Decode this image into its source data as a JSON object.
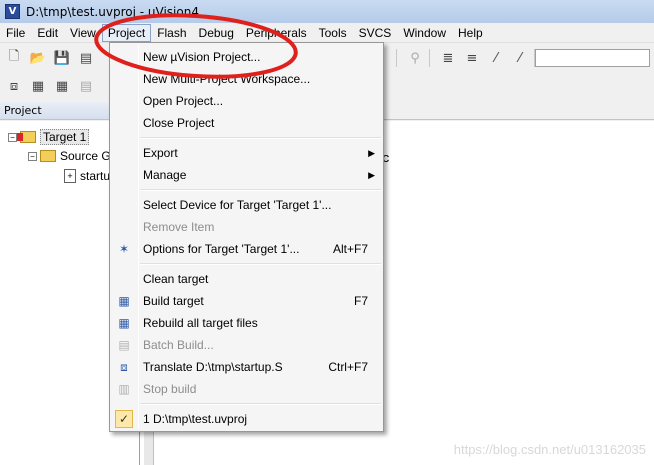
{
  "window": {
    "title": "D:\\tmp\\test.uvproj - µVision4",
    "app_icon": "V"
  },
  "menubar": {
    "items": [
      "File",
      "Edit",
      "View",
      "Project",
      "Flash",
      "Debug",
      "Peripherals",
      "Tools",
      "SVCS",
      "Window",
      "Help"
    ],
    "active": "Project"
  },
  "panel": {
    "title": "Project"
  },
  "tree": {
    "target": "Target 1",
    "group": "Source G",
    "file": "startu"
  },
  "editor": {
    "visible_char": "c"
  },
  "project_menu": {
    "items": [
      {
        "label": "New µVision Project...",
        "shortcut": "",
        "disabled": false
      },
      {
        "label": "New Multi-Project Workspace...",
        "shortcut": "",
        "disabled": false
      },
      {
        "label": "Open Project...",
        "shortcut": "",
        "disabled": false
      },
      {
        "label": "Close Project",
        "shortcut": "",
        "disabled": false
      },
      {
        "label": "Export",
        "shortcut": "",
        "submenu": true
      },
      {
        "label": "Manage",
        "shortcut": "",
        "submenu": true
      },
      {
        "label": "Select Device for Target 'Target 1'...",
        "shortcut": ""
      },
      {
        "label": "Remove Item",
        "shortcut": "",
        "disabled": true
      },
      {
        "label": "Options for Target 'Target 1'...",
        "shortcut": "Alt+F7"
      },
      {
        "label": "Clean target",
        "shortcut": ""
      },
      {
        "label": "Build target",
        "shortcut": "F7"
      },
      {
        "label": "Rebuild all target files",
        "shortcut": ""
      },
      {
        "label": "Batch Build...",
        "shortcut": "",
        "disabled": true
      },
      {
        "label": "Translate D:\\tmp\\startup.S",
        "shortcut": "Ctrl+F7"
      },
      {
        "label": "Stop build",
        "shortcut": "",
        "disabled": true
      },
      {
        "label": "1 D:\\tmp\\test.uvproj",
        "shortcut": ""
      }
    ]
  },
  "watermark": "https://blog.csdn.net/u013162035",
  "colors": {
    "annotation": "#e0201c",
    "title_bar": "#c9dbf2",
    "menu_bg": "#f5f5f5"
  }
}
